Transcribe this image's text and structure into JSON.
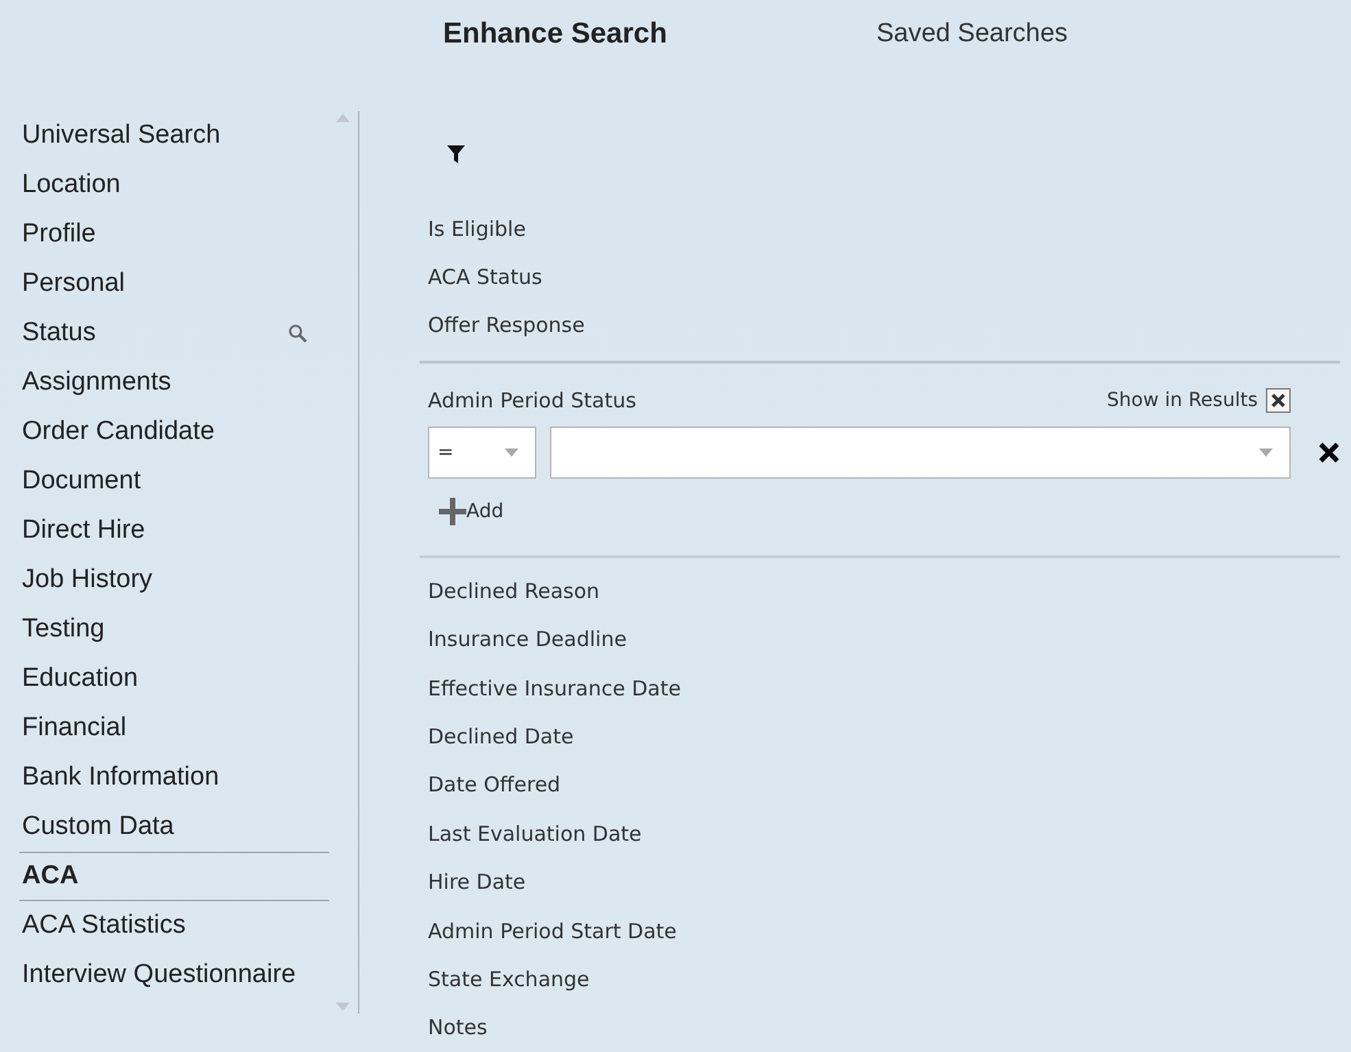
{
  "tabs": [
    {
      "label": "Enhance Search",
      "selected": true
    },
    {
      "label": "Saved Searches",
      "selected": false
    }
  ],
  "sidebar": {
    "items": [
      {
        "label": "Universal Search",
        "selected": false,
        "kind": "plain"
      },
      {
        "label": "Location",
        "selected": false,
        "kind": "plain"
      },
      {
        "label": "Profile",
        "selected": false,
        "kind": "plain"
      },
      {
        "label": "Personal",
        "selected": false,
        "kind": "plain"
      },
      {
        "label": "Status",
        "selected": false,
        "kind": "search"
      },
      {
        "label": "Assignments",
        "selected": false,
        "kind": "plain"
      },
      {
        "label": "Order Candidate",
        "selected": false,
        "kind": "plain"
      },
      {
        "label": "Document",
        "selected": false,
        "kind": "plain"
      },
      {
        "label": "Direct Hire",
        "selected": false,
        "kind": "plain"
      },
      {
        "label": "Job History",
        "selected": false,
        "kind": "plain"
      },
      {
        "label": "Testing",
        "selected": false,
        "kind": "plain"
      },
      {
        "label": "Education",
        "selected": false,
        "kind": "plain"
      },
      {
        "label": "Financial",
        "selected": false,
        "kind": "plain"
      },
      {
        "label": "Bank Information",
        "selected": false,
        "kind": "plain"
      },
      {
        "label": "Custom Data",
        "selected": false,
        "kind": "plain"
      },
      {
        "label": "ACA",
        "selected": true,
        "kind": "plain"
      },
      {
        "label": "ACA Statistics",
        "selected": false,
        "kind": "plain"
      },
      {
        "label": "Interview Questionnaire",
        "selected": false,
        "kind": "plain"
      }
    ]
  },
  "fields": [
    {
      "label": "Is Eligible",
      "expanded": false
    },
    {
      "label": "ACA Status",
      "expanded": false
    },
    {
      "label": "Offer Response",
      "expanded": false
    },
    {
      "label": "Admin Period Status",
      "expanded": true,
      "show_in_results_label": "Show in Results",
      "show_in_results": true,
      "operator": "=",
      "add_label": "Add"
    },
    {
      "label": "Declined Reason",
      "expanded": false
    },
    {
      "label": "Insurance Deadline",
      "expanded": false
    },
    {
      "label": "Effective Insurance Date",
      "expanded": false
    },
    {
      "label": "Declined Date",
      "expanded": false
    },
    {
      "label": "Date Offered",
      "expanded": false
    },
    {
      "label": "Last Evaluation Date",
      "expanded": false
    },
    {
      "label": "Hire Date",
      "expanded": false
    },
    {
      "label": "Admin Period Start Date",
      "expanded": false
    },
    {
      "label": "State Exchange",
      "expanded": false
    },
    {
      "label": "Notes",
      "expanded": false
    }
  ]
}
